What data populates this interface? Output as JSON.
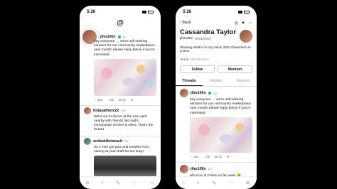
{
  "left": {
    "status": {
      "time": "5:26"
    },
    "logo_glyph": "@",
    "post1": {
      "username": "jiho100x",
      "time": "2h",
      "text": "hey everyone … we're still seeking vendors for our community marketplace next month! please reply below if you're interested.",
      "likes": "154",
      "replies": "52",
      "reposts": "12"
    },
    "post2": {
      "username": "hidayathere22",
      "time": "6m",
      "text": "Went out to dinner at the new spot nearby with friends last night. Immaculate service & vibes. That's the thread."
    },
    "post3": {
      "username": "endoatthebeach",
      "time": "6m",
      "text": "do u ever get pins and needles from staring at your draft for too long?"
    },
    "tabbar": [
      "⌂",
      "⌕",
      "✎",
      "♡",
      "☺"
    ]
  },
  "right": {
    "status": {
      "time": "5:26"
    },
    "back_label": "Back",
    "tools": [
      "◎",
      "▲",
      "⋯"
    ],
    "profile": {
      "name": "Cassandra Taylor",
      "handle": "jiho100x",
      "chip": "threads.net",
      "bio": "Sharing what's on my mind, 500 characters at a time",
      "followers": "26k followers"
    },
    "buttons": {
      "follow": "Follow",
      "mention": "Mention"
    },
    "tabs": [
      "Threads",
      "Replies",
      "Reposts"
    ],
    "post1": {
      "username": "jiho100x",
      "time": "1m",
      "text": "hey everyone … we're still seeking vendors for our community marketplace next month! please reply below if you're interested.",
      "likes": "154",
      "replies": "52",
      "reposts": "12"
    },
    "post2": {
      "username": "jiho100x",
      "time": "1d",
      "text": "whyyyyy is Friday so far away 😩"
    },
    "tabbar": [
      "⌂",
      "⌕",
      "✎",
      "♡",
      "☺"
    ]
  }
}
